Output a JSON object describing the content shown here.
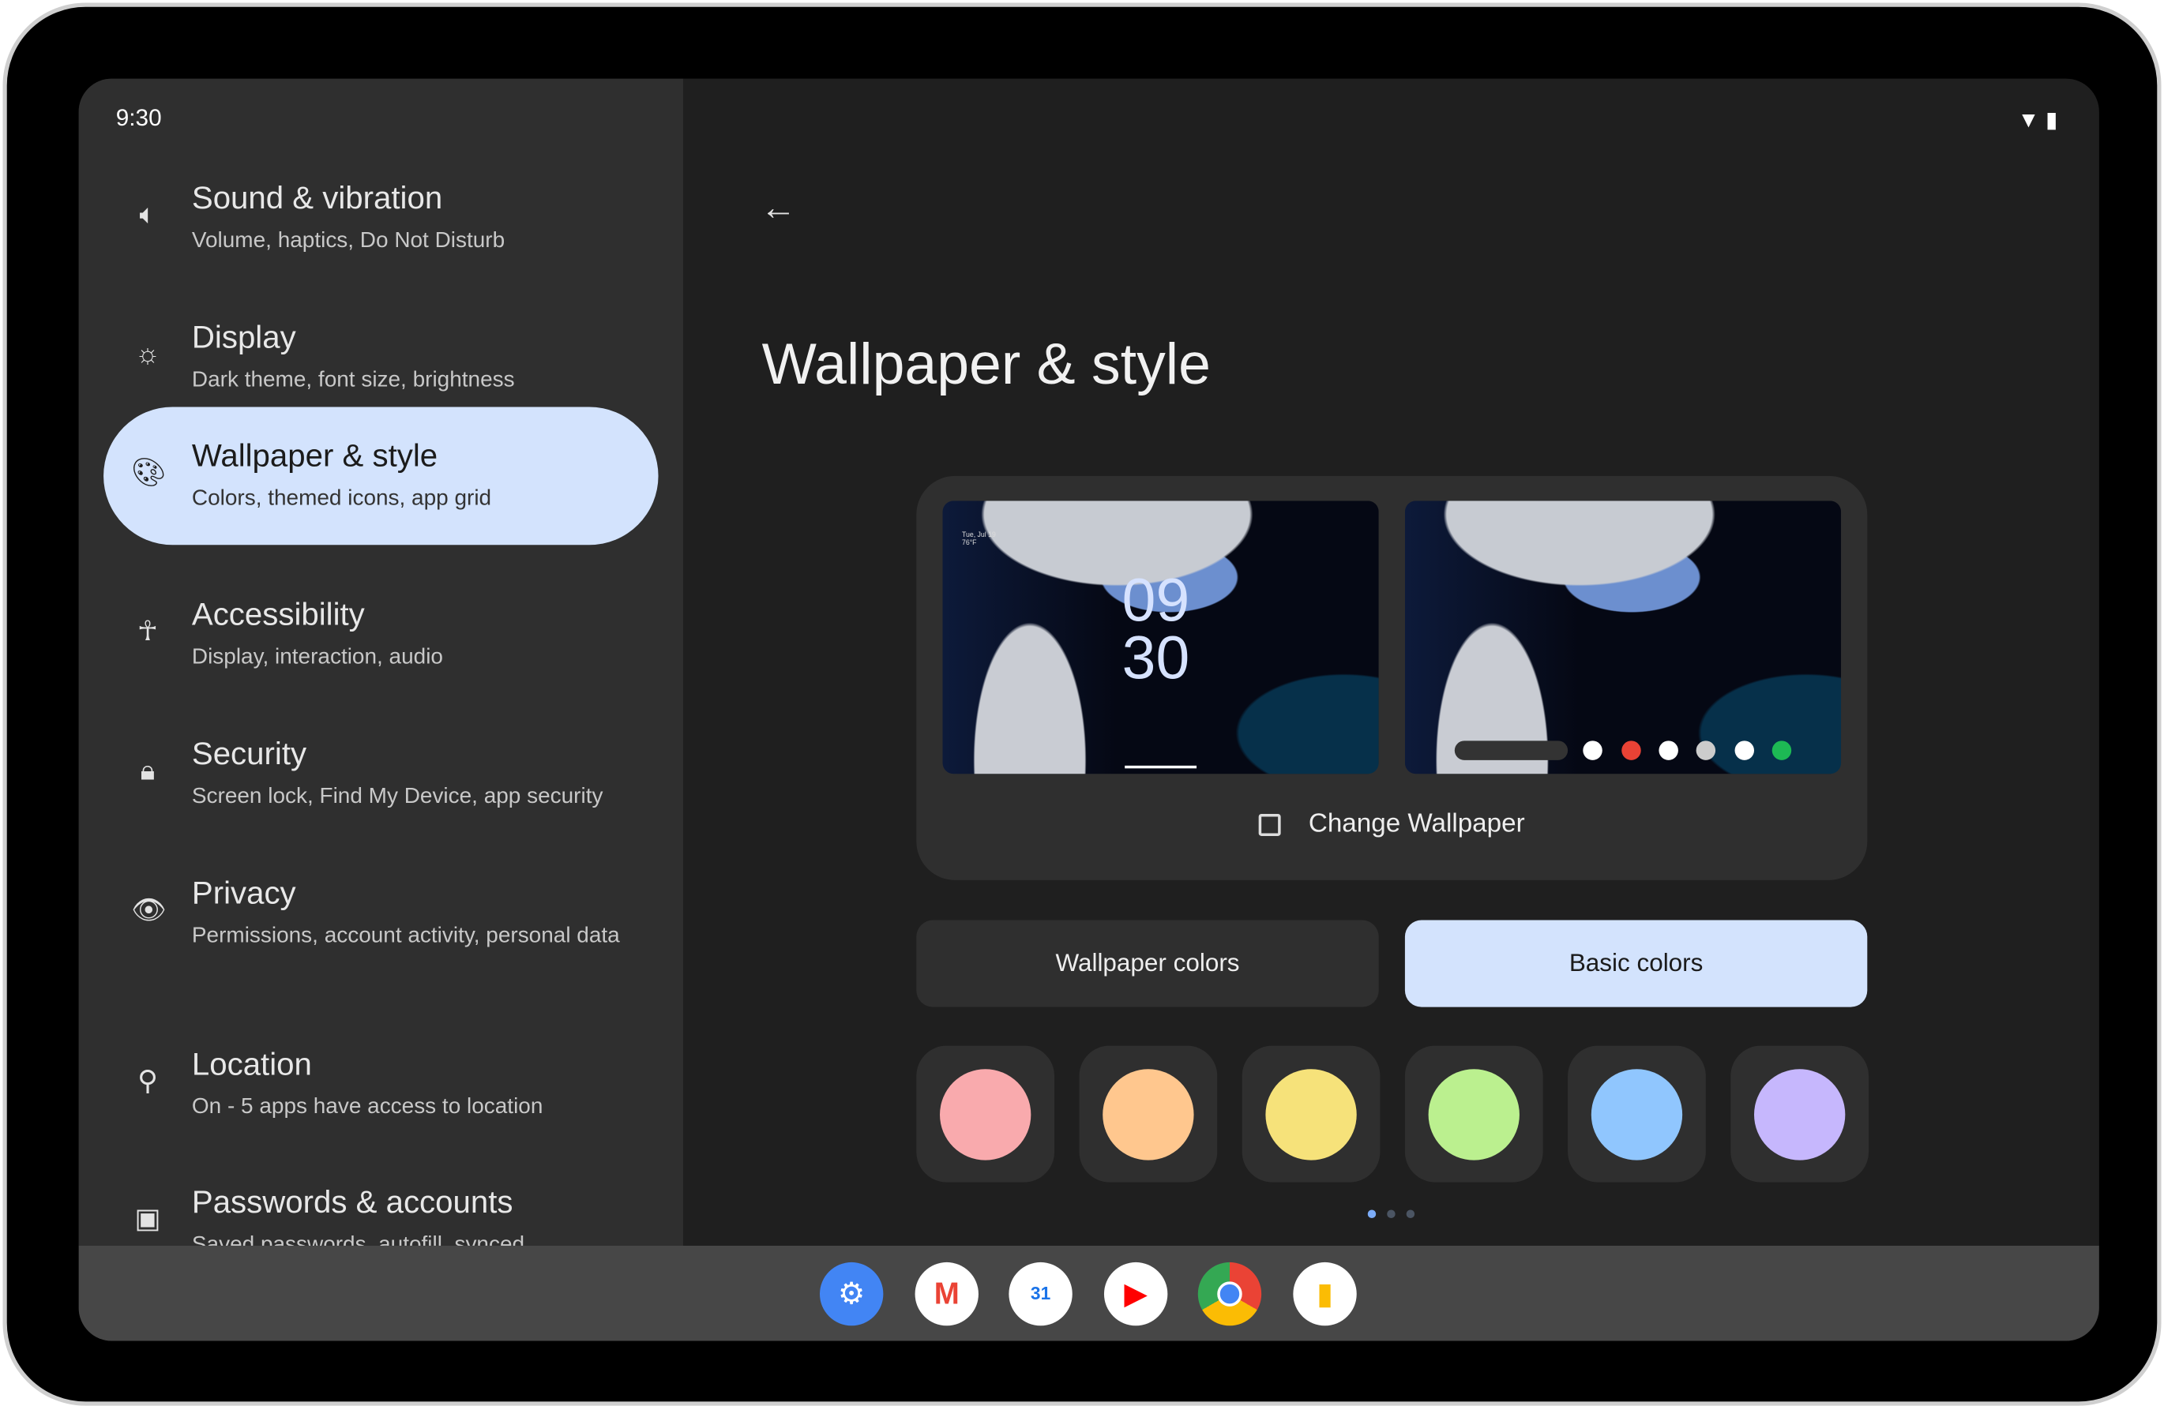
{
  "status": {
    "time": "9:30",
    "icons": [
      "wifi-icon",
      "battery-icon"
    ]
  },
  "sidebar": {
    "items": [
      {
        "title": "Sound & vibration",
        "subtitle": "Volume, haptics, Do Not Disturb",
        "icon": "speaker-icon"
      },
      {
        "title": "Display",
        "subtitle": "Dark theme, font size, brightness",
        "icon": "brightness-icon"
      },
      {
        "title": "Wallpaper & style",
        "subtitle": "Colors, themed icons, app grid",
        "icon": "palette-icon",
        "selected": true
      },
      {
        "title": "Accessibility",
        "subtitle": "Display, interaction, audio",
        "icon": "accessibility-icon"
      },
      {
        "title": "Security",
        "subtitle": "Screen lock, Find My Device, app security",
        "icon": "lock-icon"
      },
      {
        "title": "Privacy",
        "subtitle": "Permissions, account activity, personal data",
        "icon": "privacy-eye-icon"
      },
      {
        "title": "Location",
        "subtitle": "On - 5 apps have access to location",
        "icon": "location-pin-icon"
      },
      {
        "title": "Passwords & accounts",
        "subtitle": "Saved passwords, autofill, synced",
        "icon": "account-box-icon"
      }
    ]
  },
  "main": {
    "title": "Wallpaper & style",
    "lock_preview": {
      "clock_hours": "09",
      "clock_minutes": "30",
      "date": "Tue, Jul 19",
      "weather": "76°F"
    },
    "change_wallpaper": "Change Wallpaper",
    "tabs": [
      {
        "label": "Wallpaper colors",
        "selected": false
      },
      {
        "label": "Basic colors",
        "selected": true
      }
    ],
    "swatches": [
      "#f9aaad",
      "#ffc78e",
      "#f6e27a",
      "#bbf08f",
      "#90c6fe",
      "#c6b7fd"
    ],
    "page_indicator": {
      "pages": 3,
      "current": 1
    }
  },
  "taskbar": {
    "apps": [
      "Settings",
      "Gmail",
      "Calendar",
      "YouTube",
      "Chrome",
      "Keep"
    ],
    "calendar_day": "31"
  },
  "colors": {
    "accent": "#d3e3fd",
    "sidebar": "#2f2f2f",
    "background": "#1f1f1f",
    "taskbar": "#474747"
  }
}
